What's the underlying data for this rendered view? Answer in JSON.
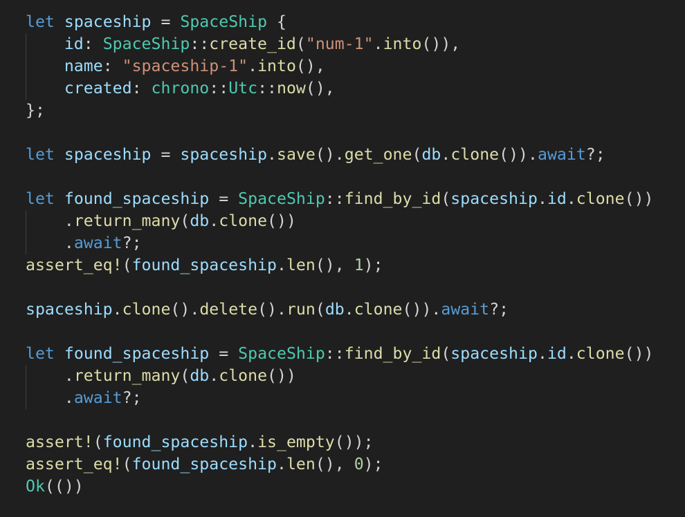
{
  "editor": {
    "background": "#1f1f1f",
    "theme_colors": {
      "keyword": "#569cd6",
      "variable": "#9cdcfe",
      "type": "#4ec9b0",
      "function": "#dcdcaa",
      "string": "#ce9178",
      "number": "#b5cea8",
      "punctuation": "#d4d4d4"
    },
    "lines": [
      [
        [
          "kw",
          "let"
        ],
        [
          "op",
          " "
        ],
        [
          "var",
          "spaceship"
        ],
        [
          "op",
          " = "
        ],
        [
          "ty",
          "SpaceShip"
        ],
        [
          "op",
          " {"
        ]
      ],
      [
        [
          "op",
          "    "
        ],
        [
          "var",
          "id"
        ],
        [
          "op",
          ": "
        ],
        [
          "ty",
          "SpaceShip"
        ],
        [
          "op",
          "::"
        ],
        [
          "fn",
          "create_id"
        ],
        [
          "op",
          "("
        ],
        [
          "str",
          "\"num-1\""
        ],
        [
          "op",
          "."
        ],
        [
          "fn",
          "into"
        ],
        [
          "op",
          "()),"
        ]
      ],
      [
        [
          "op",
          "    "
        ],
        [
          "var",
          "name"
        ],
        [
          "op",
          ": "
        ],
        [
          "str",
          "\"spaceship-1\""
        ],
        [
          "op",
          "."
        ],
        [
          "fn",
          "into"
        ],
        [
          "op",
          "(),"
        ]
      ],
      [
        [
          "op",
          "    "
        ],
        [
          "var",
          "created"
        ],
        [
          "op",
          ": "
        ],
        [
          "ty",
          "chrono"
        ],
        [
          "op",
          "::"
        ],
        [
          "ty",
          "Utc"
        ],
        [
          "op",
          "::"
        ],
        [
          "fn",
          "now"
        ],
        [
          "op",
          "(),"
        ]
      ],
      [
        [
          "op",
          "};"
        ]
      ],
      [],
      [
        [
          "kw",
          "let"
        ],
        [
          "op",
          " "
        ],
        [
          "var",
          "spaceship"
        ],
        [
          "op",
          " = "
        ],
        [
          "var",
          "spaceship"
        ],
        [
          "op",
          "."
        ],
        [
          "fn",
          "save"
        ],
        [
          "op",
          "()."
        ],
        [
          "fn",
          "get_one"
        ],
        [
          "op",
          "("
        ],
        [
          "var",
          "db"
        ],
        [
          "op",
          "."
        ],
        [
          "fn",
          "clone"
        ],
        [
          "op",
          "())."
        ],
        [
          "kw",
          "await"
        ],
        [
          "op",
          "?;"
        ]
      ],
      [],
      [
        [
          "kw",
          "let"
        ],
        [
          "op",
          " "
        ],
        [
          "var",
          "found_spaceship"
        ],
        [
          "op",
          " = "
        ],
        [
          "ty",
          "SpaceShip"
        ],
        [
          "op",
          "::"
        ],
        [
          "fn",
          "find_by_id"
        ],
        [
          "op",
          "("
        ],
        [
          "var",
          "spaceship"
        ],
        [
          "op",
          "."
        ],
        [
          "var",
          "id"
        ],
        [
          "op",
          "."
        ],
        [
          "fn",
          "clone"
        ],
        [
          "op",
          "())"
        ]
      ],
      [
        [
          "op",
          "    ."
        ],
        [
          "fn",
          "return_many"
        ],
        [
          "op",
          "("
        ],
        [
          "var",
          "db"
        ],
        [
          "op",
          "."
        ],
        [
          "fn",
          "clone"
        ],
        [
          "op",
          "())"
        ]
      ],
      [
        [
          "op",
          "    ."
        ],
        [
          "kw",
          "await"
        ],
        [
          "op",
          "?;"
        ]
      ],
      [
        [
          "fn",
          "assert_eq!"
        ],
        [
          "op",
          "("
        ],
        [
          "var",
          "found_spaceship"
        ],
        [
          "op",
          "."
        ],
        [
          "fn",
          "len"
        ],
        [
          "op",
          "(), "
        ],
        [
          "num",
          "1"
        ],
        [
          "op",
          ");"
        ]
      ],
      [],
      [
        [
          "var",
          "spaceship"
        ],
        [
          "op",
          "."
        ],
        [
          "fn",
          "clone"
        ],
        [
          "op",
          "()."
        ],
        [
          "fn",
          "delete"
        ],
        [
          "op",
          "()."
        ],
        [
          "fn",
          "run"
        ],
        [
          "op",
          "("
        ],
        [
          "var",
          "db"
        ],
        [
          "op",
          "."
        ],
        [
          "fn",
          "clone"
        ],
        [
          "op",
          "())."
        ],
        [
          "kw",
          "await"
        ],
        [
          "op",
          "?;"
        ]
      ],
      [],
      [
        [
          "kw",
          "let"
        ],
        [
          "op",
          " "
        ],
        [
          "var",
          "found_spaceship"
        ],
        [
          "op",
          " = "
        ],
        [
          "ty",
          "SpaceShip"
        ],
        [
          "op",
          "::"
        ],
        [
          "fn",
          "find_by_id"
        ],
        [
          "op",
          "("
        ],
        [
          "var",
          "spaceship"
        ],
        [
          "op",
          "."
        ],
        [
          "var",
          "id"
        ],
        [
          "op",
          "."
        ],
        [
          "fn",
          "clone"
        ],
        [
          "op",
          "())"
        ]
      ],
      [
        [
          "op",
          "    ."
        ],
        [
          "fn",
          "return_many"
        ],
        [
          "op",
          "("
        ],
        [
          "var",
          "db"
        ],
        [
          "op",
          "."
        ],
        [
          "fn",
          "clone"
        ],
        [
          "op",
          "())"
        ]
      ],
      [
        [
          "op",
          "    ."
        ],
        [
          "kw",
          "await"
        ],
        [
          "op",
          "?;"
        ]
      ],
      [],
      [
        [
          "fn",
          "assert!"
        ],
        [
          "op",
          "("
        ],
        [
          "var",
          "found_spaceship"
        ],
        [
          "op",
          "."
        ],
        [
          "fn",
          "is_empty"
        ],
        [
          "op",
          "());"
        ]
      ],
      [
        [
          "fn",
          "assert_eq!"
        ],
        [
          "op",
          "("
        ],
        [
          "var",
          "found_spaceship"
        ],
        [
          "op",
          "."
        ],
        [
          "fn",
          "len"
        ],
        [
          "op",
          "(), "
        ],
        [
          "num",
          "0"
        ],
        [
          "op",
          ");"
        ]
      ],
      [
        [
          "ty",
          "Ok"
        ],
        [
          "op",
          "(())"
        ]
      ]
    ]
  }
}
